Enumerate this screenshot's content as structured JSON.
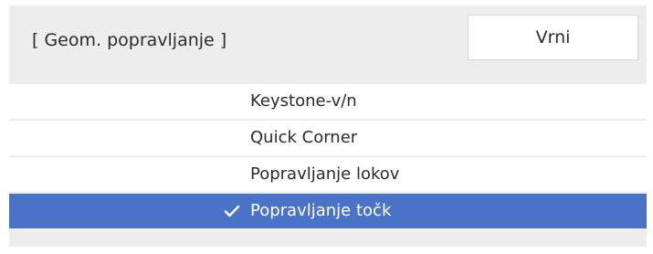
{
  "dialog": {
    "title": "[ Geom. popravljanje ]",
    "back_label": "Vrni"
  },
  "menu": {
    "items": [
      {
        "label": "Keystone-v/n",
        "selected": false
      },
      {
        "label": "Quick Corner",
        "selected": false
      },
      {
        "label": "Popravljanje lokov",
        "selected": false
      },
      {
        "label": "Popravljanje točk",
        "selected": true
      }
    ],
    "selected_icon": "checkmark-icon"
  },
  "colors": {
    "panel_background": "#ededed",
    "item_background": "#ffffff",
    "selected_background": "#4a72c7",
    "text": "#2b2b2b",
    "selected_text": "#ffffff"
  }
}
